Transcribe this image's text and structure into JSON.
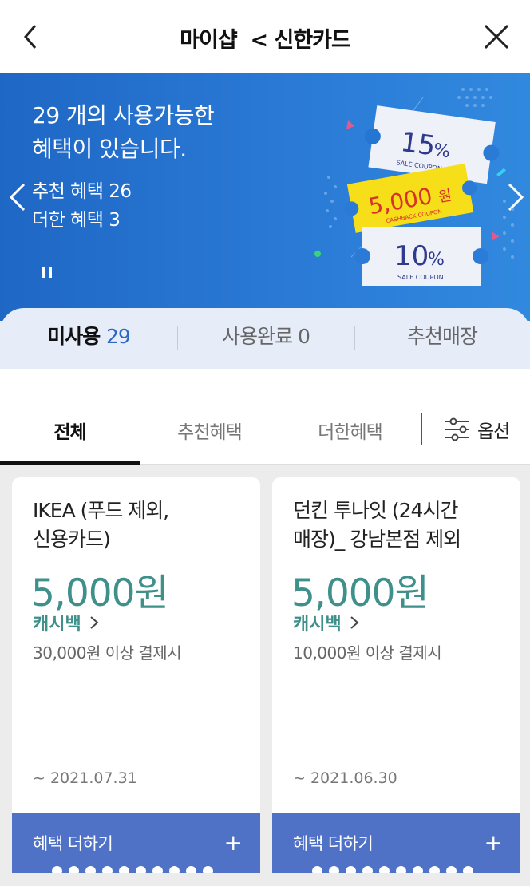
{
  "header": {
    "title": "마이샵  < 신한카드",
    "back_icon": "chevron-left-icon",
    "close_icon": "close-icon"
  },
  "banner": {
    "headline_line1": "29 개의 사용가능한",
    "headline_line2": "혜택이 있습니다.",
    "recommended": "추천 혜택 26",
    "added": "더한 혜택 3",
    "coupons": [
      {
        "value": "15",
        "unit": "%",
        "caption": "SALE COUPON"
      },
      {
        "value": "5,000",
        "unit": "원",
        "caption": "CASHBACK COUPON"
      },
      {
        "value": "10",
        "unit": "%",
        "caption": "SALE COUPON"
      }
    ]
  },
  "usage_tabs": {
    "unused_label": "미사용",
    "unused_count": "29",
    "used_label": "사용완료 0",
    "stores_label": "추천매장"
  },
  "filter_tabs": {
    "all": "전체",
    "recommended": "추천혜택",
    "added": "더한혜택",
    "options": "옵션"
  },
  "cards": [
    {
      "title_line1": "IKEA (푸드 제외,",
      "title_line2": "신용카드)",
      "amount": "5,000원",
      "type": "캐시백",
      "condition": "30,000원 이상 결제시",
      "date": "~ 2021.07.31",
      "button": "혜택 더하기",
      "plus": "+"
    },
    {
      "title_line1": "던킨 투나잇 (24시간",
      "title_line2": "매장)_ 강남본점 제외",
      "amount": "5,000원",
      "type": "캐시백",
      "condition": "10,000원 이상 결제시",
      "date": "~ 2021.06.30",
      "button": "혜택 더하기",
      "plus": "+"
    }
  ],
  "colors": {
    "banner": "#2a7ad6",
    "accent_teal": "#3f8f8a",
    "button_blue": "#4f72c6",
    "count_blue": "#2e66c4"
  }
}
